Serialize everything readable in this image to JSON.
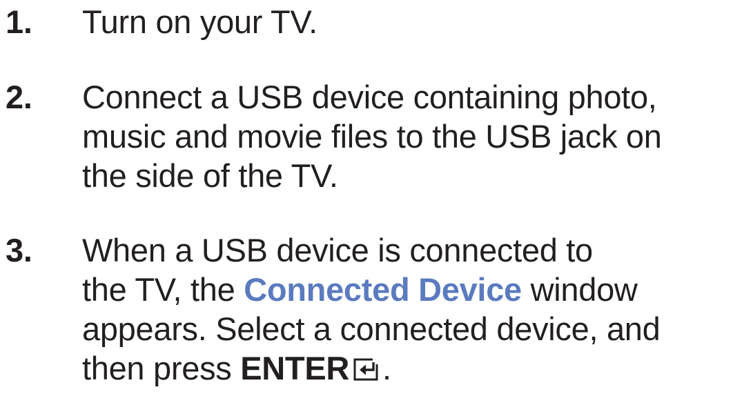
{
  "steps": [
    {
      "number": "1.",
      "lines": [
        "Turn on your TV."
      ]
    },
    {
      "number": "2.",
      "lines": [
        "Connect a USB device containing photo,",
        "music and movie files to the USB jack on",
        "the side of the TV."
      ]
    },
    {
      "number": "3.",
      "line1": "When a USB device is connected to",
      "line2_before": "the TV, the ",
      "line2_highlight": "Connected Device",
      "line2_after": " window",
      "line3": "appears. Select a connected device, and",
      "line4_before": "then press ",
      "line4_key": "ENTER",
      "line4_icon": "enter-icon",
      "line4_after": "."
    }
  ],
  "colors": {
    "text": "#231f20",
    "highlight": "#5b7bbf"
  }
}
